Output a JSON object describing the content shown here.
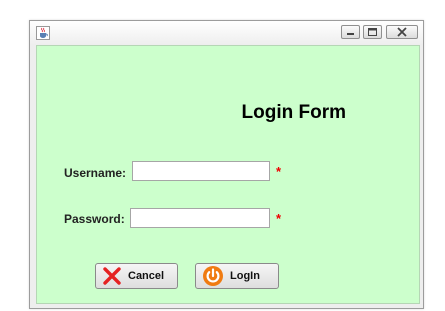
{
  "window": {
    "minimize_icon": "minimize-icon",
    "maximize_icon": "maximize-icon",
    "close_icon": "close-icon",
    "app_icon": "java-cup-icon"
  },
  "form": {
    "title": "Login Form",
    "username_label": "Username:",
    "username_value": "",
    "password_label": "Password:",
    "password_value": "",
    "required_marker": "*",
    "cancel_label": "Cancel",
    "login_label": "LogIn",
    "cancel_icon": "x-icon",
    "login_icon": "power-icon"
  },
  "colors": {
    "panel_background": "#ccffcc",
    "required": "#ee0000",
    "cancel_icon": "#e52222",
    "login_icon": "#f07b11"
  }
}
